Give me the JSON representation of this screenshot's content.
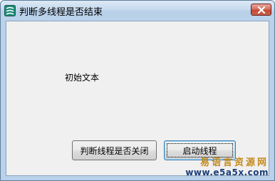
{
  "window": {
    "title": "判断多线程是否结束",
    "icon": "app-icon",
    "close_icon": "close-icon",
    "close_color": "#c75a47"
  },
  "content": {
    "label_text": "初始文本",
    "check_button_label": "判断线程是否关闭",
    "start_button_label": "启动线程"
  },
  "watermark": {
    "brand": "易语言资源网",
    "url": "www.e5a5x.com"
  }
}
